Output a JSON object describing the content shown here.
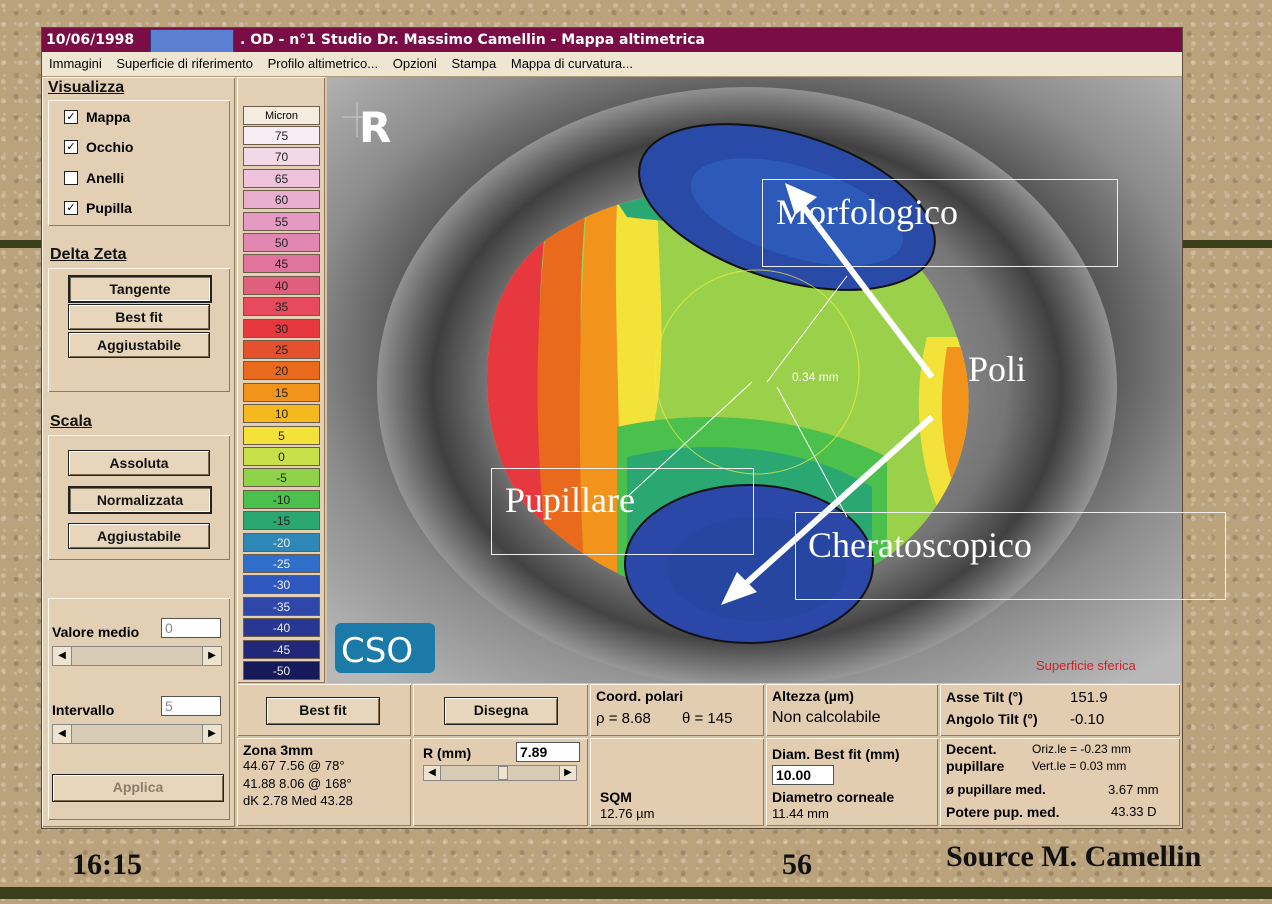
{
  "window": {
    "title_date": "10/06/1998",
    "title_rest": ". OD - n°1 Studio Dr. Massimo Camellin - Mappa altimetrica"
  },
  "menu": [
    "Immagini",
    "Superficie di riferimento",
    "Profilo altimetrico...",
    "Opzioni",
    "Stampa",
    "Mappa di curvatura..."
  ],
  "visualizza": {
    "title": "Visualizza",
    "items": [
      {
        "label": "Mappa",
        "checked": true
      },
      {
        "label": "Occhio",
        "checked": true
      },
      {
        "label": "Anelli",
        "checked": false
      },
      {
        "label": "Pupilla",
        "checked": true
      }
    ]
  },
  "delta_zeta": {
    "title": "Delta Zeta",
    "buttons": [
      "Tangente",
      "Best fit",
      "Aggiustabile"
    ]
  },
  "scala": {
    "title": "Scala",
    "buttons": [
      "Assoluta",
      "Normalizzata",
      "Aggiustabile"
    ]
  },
  "valore_medio": {
    "label": "Valore medio",
    "value": "0"
  },
  "intervallo": {
    "label": "Intervallo",
    "value": "5"
  },
  "applica_label": "Applica",
  "color_scale": {
    "header": "Micron",
    "values": [
      "75",
      "70",
      "65",
      "60",
      "55",
      "50",
      "45",
      "40",
      "35",
      "30",
      "25",
      "20",
      "15",
      "10",
      "5",
      "0",
      "-5",
      "-10",
      "-15",
      "-20",
      "-25",
      "-30",
      "-35",
      "-40",
      "-45",
      "-50"
    ],
    "colors": [
      "#f6eef4",
      "#f3d9e8",
      "#efc3dc",
      "#eaaed0",
      "#e59ac3",
      "#e286b2",
      "#e0749c",
      "#e05f7d",
      "#e64a5c",
      "#e8383f",
      "#e5502e",
      "#ea6a1d",
      "#f2931c",
      "#f6b81f",
      "#f3e23a",
      "#c8e04a",
      "#8fd34b",
      "#4cc04c",
      "#2ba772",
      "#2e88b7",
      "#2f6fca",
      "#2f58be",
      "#2e47a8",
      "#283791",
      "#21287a",
      "#161a5a"
    ]
  },
  "map": {
    "eye_label": "R",
    "logo_text": "CSO",
    "surface_label": "Superficie sferica",
    "distance_label": "0.34 mm"
  },
  "annotations": {
    "morfologico": "Morfologico",
    "poli": "Poli",
    "pupillare": "Pupillare",
    "cheratoscopico": "Cheratoscopico"
  },
  "bottom": {
    "best_fit_button": "Best fit",
    "disegna_button": "Disegna",
    "zona_title": "Zona 3mm",
    "zona_lines": [
      "44.67 7.56 @ 78°",
      "41.88 8.06 @ 168°",
      "dK 2.78 Med 43.28"
    ],
    "r_label": "R (mm)",
    "r_value": "7.89",
    "coord_title": "Coord. polari",
    "coord_rho": "ρ = 8.68",
    "coord_theta": "θ = 145",
    "sqm_label": "SQM",
    "sqm_value": "12.76 µm",
    "altezza_title": "Altezza (µm)",
    "altezza_value": "Non calcolabile",
    "diam_best_fit_label": "Diam. Best fit (mm)",
    "diam_best_fit_value": "10.00",
    "diam_corneale_label": "Diametro corneale",
    "diam_corneale_value": "11.44 mm",
    "asse_tilt_label": "Asse Tilt (°)",
    "asse_tilt_value": "151.9",
    "angolo_tilt_label": "Angolo Tilt (°)",
    "angolo_tilt_value": "-0.10",
    "decent_label": "Decent.",
    "pupillare_label": "pupillare",
    "oriz_value": "Oriz.le = -0.23 mm",
    "vert_value": "Vert.le = 0.03 mm",
    "pup_med_label": "ø pupillare med.",
    "pup_med_value": "3.67 mm",
    "potere_label": "Potere pup. med.",
    "potere_value": "43.33 D"
  },
  "footer": {
    "time": "16:15",
    "page": "56",
    "source": "Source M. Camellin"
  }
}
